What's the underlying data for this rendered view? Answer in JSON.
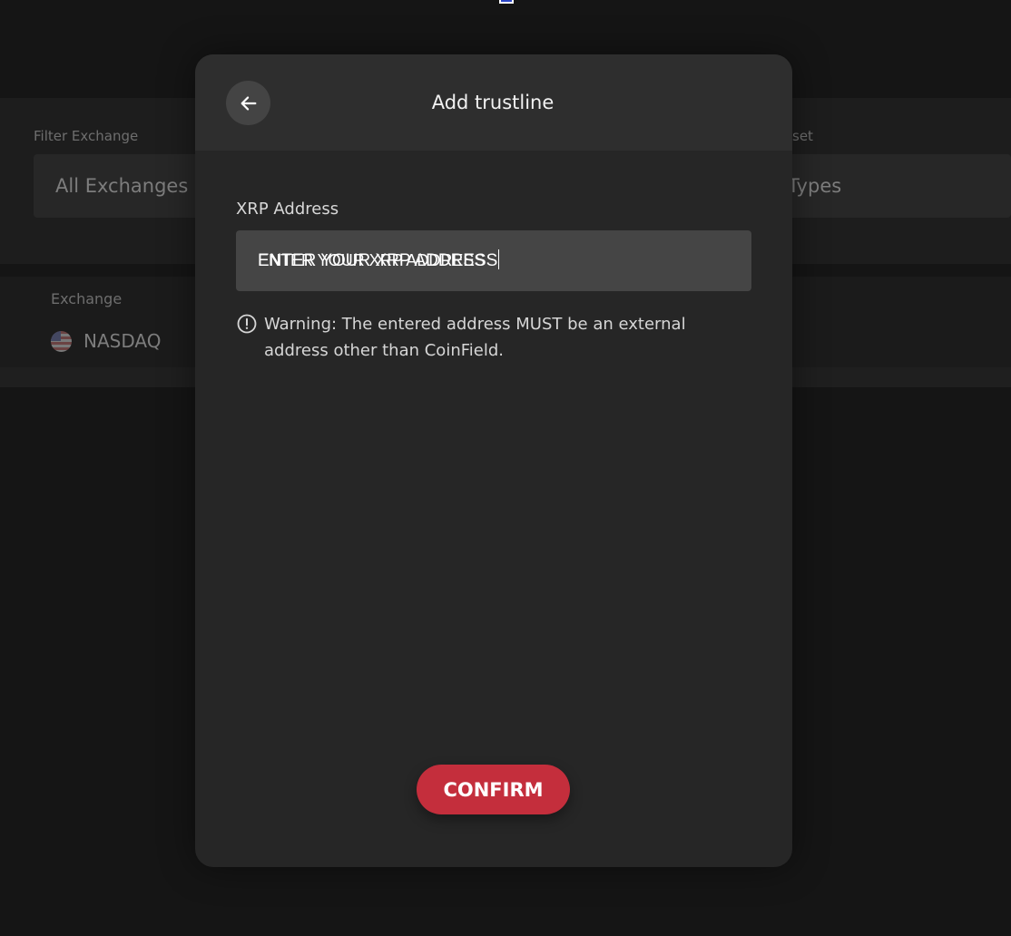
{
  "background": {
    "filter_exchange": {
      "label": "Filter Exchange",
      "value": "All Exchanges"
    },
    "filter_asset": {
      "label_fragment": "set",
      "value_fragment": "Types"
    },
    "table": {
      "column_header": "Exchange",
      "rows": [
        {
          "exchange": "NASDAQ",
          "icon": "us-flag-icon"
        }
      ]
    }
  },
  "modal": {
    "title": "Add trustline",
    "back_icon": "arrow-left-icon",
    "field_label": "XRP Address",
    "input": {
      "value": "ENTER YOUR XRP ADDRESS",
      "placeholder": "ENTER YOUR XRP ADDRESS"
    },
    "warning": {
      "icon": "exclamation-circle-icon",
      "text": "Warning: The entered address MUST be an external address other than CoinField."
    },
    "confirm_label": "CONFIRM"
  },
  "colors": {
    "page_background": "#151515",
    "modal_background": "#262626",
    "modal_header": "#2e2e2e",
    "input_background": "#454545",
    "confirm_button": "#c42e3c",
    "text_primary": "#f2f2f2"
  }
}
